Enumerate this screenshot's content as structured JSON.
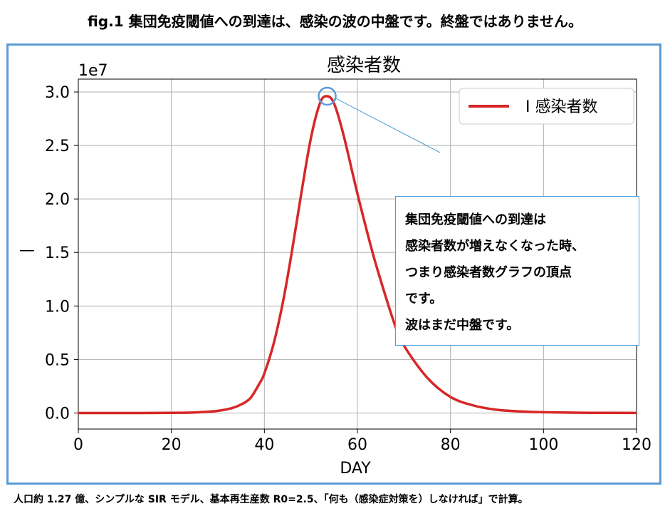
{
  "figure_title": "fig.1 集団免疫閾値への到達は、感染の波の中盤です。終盤ではありません。",
  "footnote": "人口約 1.27 億、シンプルな SIR モデル、基本再生産数 R0=2.5、「何も（感染症対策を）しなければ」で計算。",
  "annotation": {
    "lines": [
      "集団免疫閾値への到達は",
      "感染者数が増えなくなった時、",
      "つまり感染者数グラフの頂点",
      "です。",
      "波はまだ中盤です。"
    ],
    "marker_point": {
      "x": 53.5,
      "y": 29600000.0
    },
    "marker_color": "#5b9bd5",
    "box_border_color": "#4a9fd8"
  },
  "chart_data": {
    "type": "line",
    "title": "感染者数",
    "xlabel": "DAY",
    "ylabel": "—",
    "y_offset_label": "1e7",
    "xlim": [
      0,
      120
    ],
    "ylim": [
      -1500000.0,
      31200000.0
    ],
    "x_ticks": [
      0,
      20,
      40,
      60,
      80,
      100,
      120
    ],
    "x_tick_labels": [
      "0",
      "20",
      "40",
      "60",
      "80",
      "100",
      "120"
    ],
    "y_ticks": [
      0,
      5000000,
      10000000,
      15000000,
      20000000,
      25000000,
      30000000
    ],
    "y_tick_labels": [
      "0.0",
      "0.5",
      "1.0",
      "1.5",
      "2.0",
      "2.5",
      "3.0"
    ],
    "grid": true,
    "legend_position": "top-right",
    "series": [
      {
        "name": "I 感染者数",
        "color": "#d62728",
        "points": [
          [
            0,
            0
          ],
          [
            10,
            0
          ],
          [
            20,
            10000
          ],
          [
            25,
            50000
          ],
          [
            30,
            200000
          ],
          [
            33,
            450000
          ],
          [
            35,
            800000
          ],
          [
            37,
            1400000
          ],
          [
            39,
            2800000
          ],
          [
            40,
            3700000
          ],
          [
            42,
            6500000
          ],
          [
            44,
            10400000
          ],
          [
            46,
            15300000
          ],
          [
            48,
            20700000
          ],
          [
            50,
            25700000
          ],
          [
            52,
            29000000
          ],
          [
            53.5,
            29600000
          ],
          [
            55,
            28900000
          ],
          [
            57,
            26000000
          ],
          [
            60,
            20500000
          ],
          [
            63,
            15400000
          ],
          [
            65,
            12400000
          ],
          [
            68,
            8300000
          ],
          [
            70,
            6300000
          ],
          [
            75,
            3300000
          ],
          [
            80,
            1500000
          ],
          [
            85,
            700000
          ],
          [
            90,
            300000
          ],
          [
            95,
            150000
          ],
          [
            100,
            70000
          ],
          [
            110,
            20000
          ],
          [
            120,
            5000
          ]
        ]
      }
    ]
  }
}
